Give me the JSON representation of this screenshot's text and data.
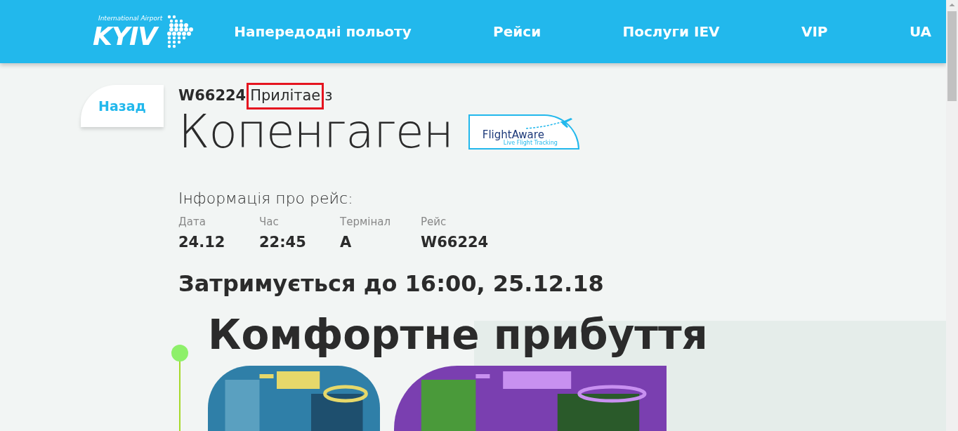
{
  "logo": {
    "tagline": "International Airport",
    "name": "KYIV"
  },
  "nav": [
    {
      "label": "Напередодні польоту"
    },
    {
      "label": "Рейси"
    },
    {
      "label": "Послуги IEV"
    },
    {
      "label": "VIP"
    },
    {
      "label": "UA"
    }
  ],
  "back_button": "Назад",
  "flight": {
    "number": "W66224",
    "status": "Прилітае",
    "status_highlighted": true,
    "preposition": "з",
    "city": "Копенгаген"
  },
  "flightaware": {
    "name": "FlightAware",
    "tagline": "Live Flight Tracking"
  },
  "info": {
    "heading": "Інформація про рейс:",
    "fields": [
      {
        "label": "Дата",
        "value": "24.12"
      },
      {
        "label": "Час",
        "value": "22:45"
      },
      {
        "label": "Термінал",
        "value": "A"
      },
      {
        "label": "Рейс",
        "value": "W66224"
      }
    ]
  },
  "delay": "Затримується до 16:00, 25.12.18",
  "section": {
    "title": "Комфортне прибуття"
  }
}
